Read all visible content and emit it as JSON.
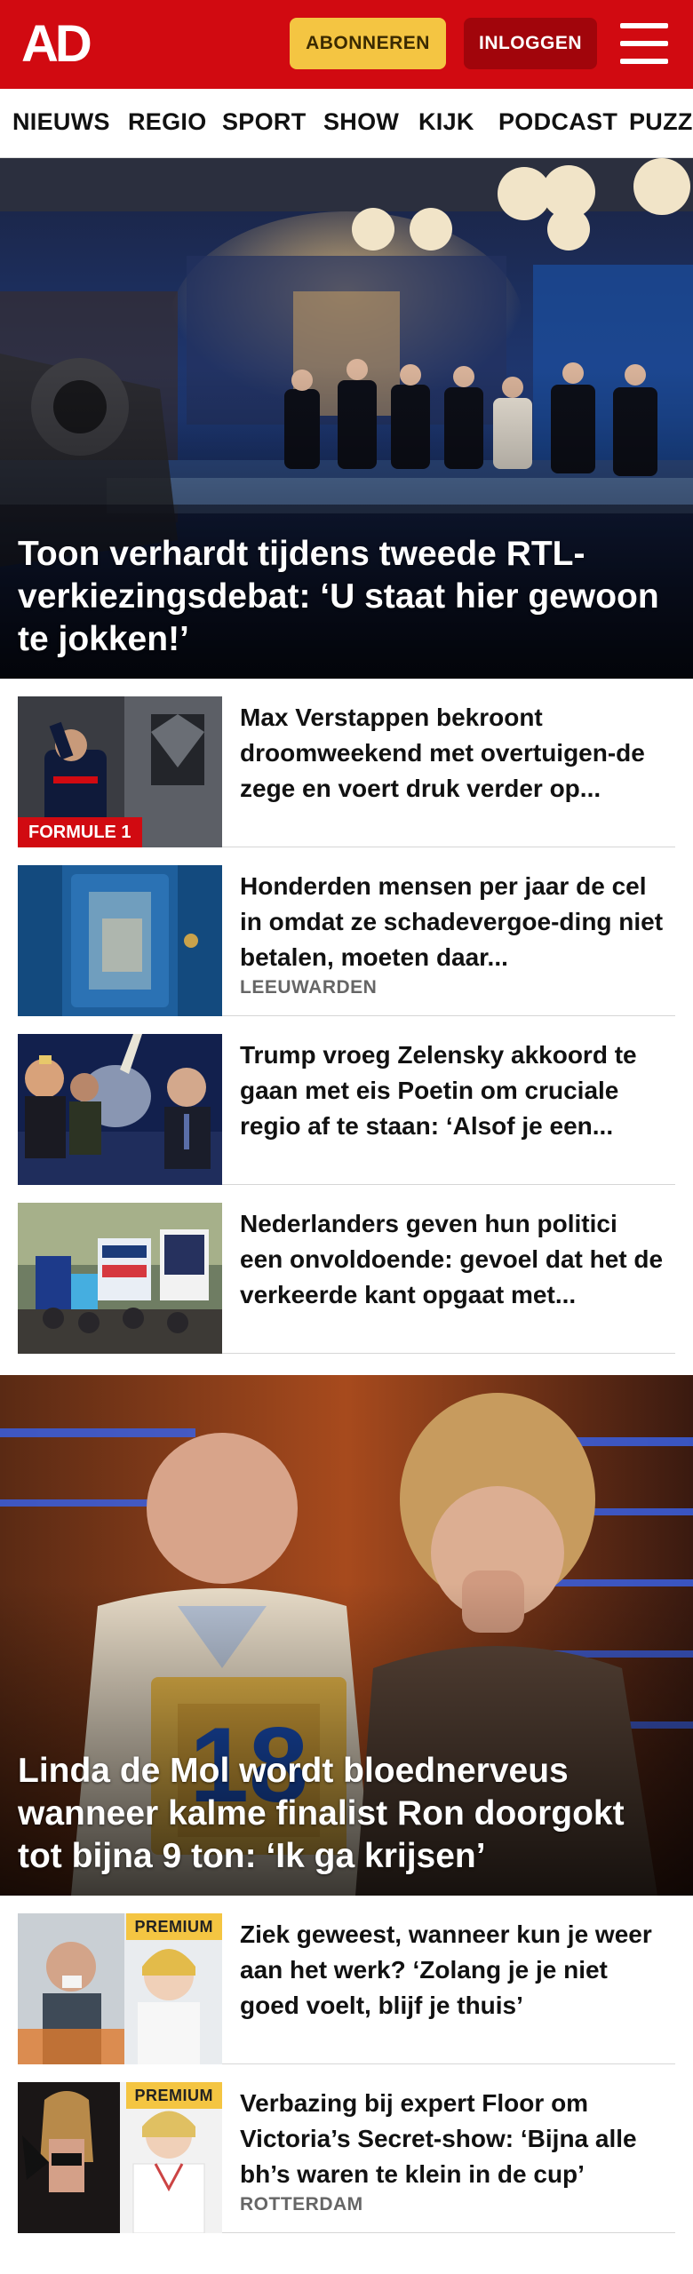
{
  "header": {
    "logo": "AD",
    "subscribe_label": "ABONNEREN",
    "login_label": "INLOGGEN",
    "brand_color": "#d10a11"
  },
  "nav": {
    "items": [
      "NIEUWS",
      "REGIO",
      "SPORT",
      "SHOW",
      "KIJK",
      "PODCAST",
      "PUZZ"
    ]
  },
  "hero1": {
    "title": "Toon verhardt tijdens tweede RTL-verkiezingsdebat: ‘U staat hier gewoon te jokken!’"
  },
  "articles1": [
    {
      "title": "Max Verstappen bekroont droomweekend met overtuigen-de zege en voert druk verder op...",
      "tag": "FORMULE 1",
      "location": ""
    },
    {
      "title": "Honderden mensen per jaar de cel in omdat ze schadevergoe-ding niet betalen, moeten daar...",
      "tag": "",
      "location": "LEEUWARDEN"
    },
    {
      "title": "Trump vroeg Zelensky akkoord te gaan met eis Poetin om cruciale regio af te staan: ‘Alsof je een...",
      "tag": "",
      "location": ""
    },
    {
      "title": "Nederlanders geven hun politici een onvoldoende: gevoel dat het de verkeerde kant opgaat met...",
      "tag": "",
      "location": ""
    }
  ],
  "hero2": {
    "title": "Linda de Mol wordt bloednerveus wanneer kalme finalist Ron doorgokt tot bijna 9 ton: ‘Ik ga krijsen’"
  },
  "articles2": [
    {
      "title": "Ziek geweest, wanneer kun je weer aan het werk? ‘Zolang je je niet goed voelt, blijf je thuis’",
      "tag": "PREMIUM",
      "location": ""
    },
    {
      "title": "Verbazing bij expert Floor om Victoria’s Secret-show: ‘Bijna alle bh’s waren te klein in de cup’",
      "tag": "PREMIUM",
      "location": "ROTTERDAM"
    }
  ]
}
